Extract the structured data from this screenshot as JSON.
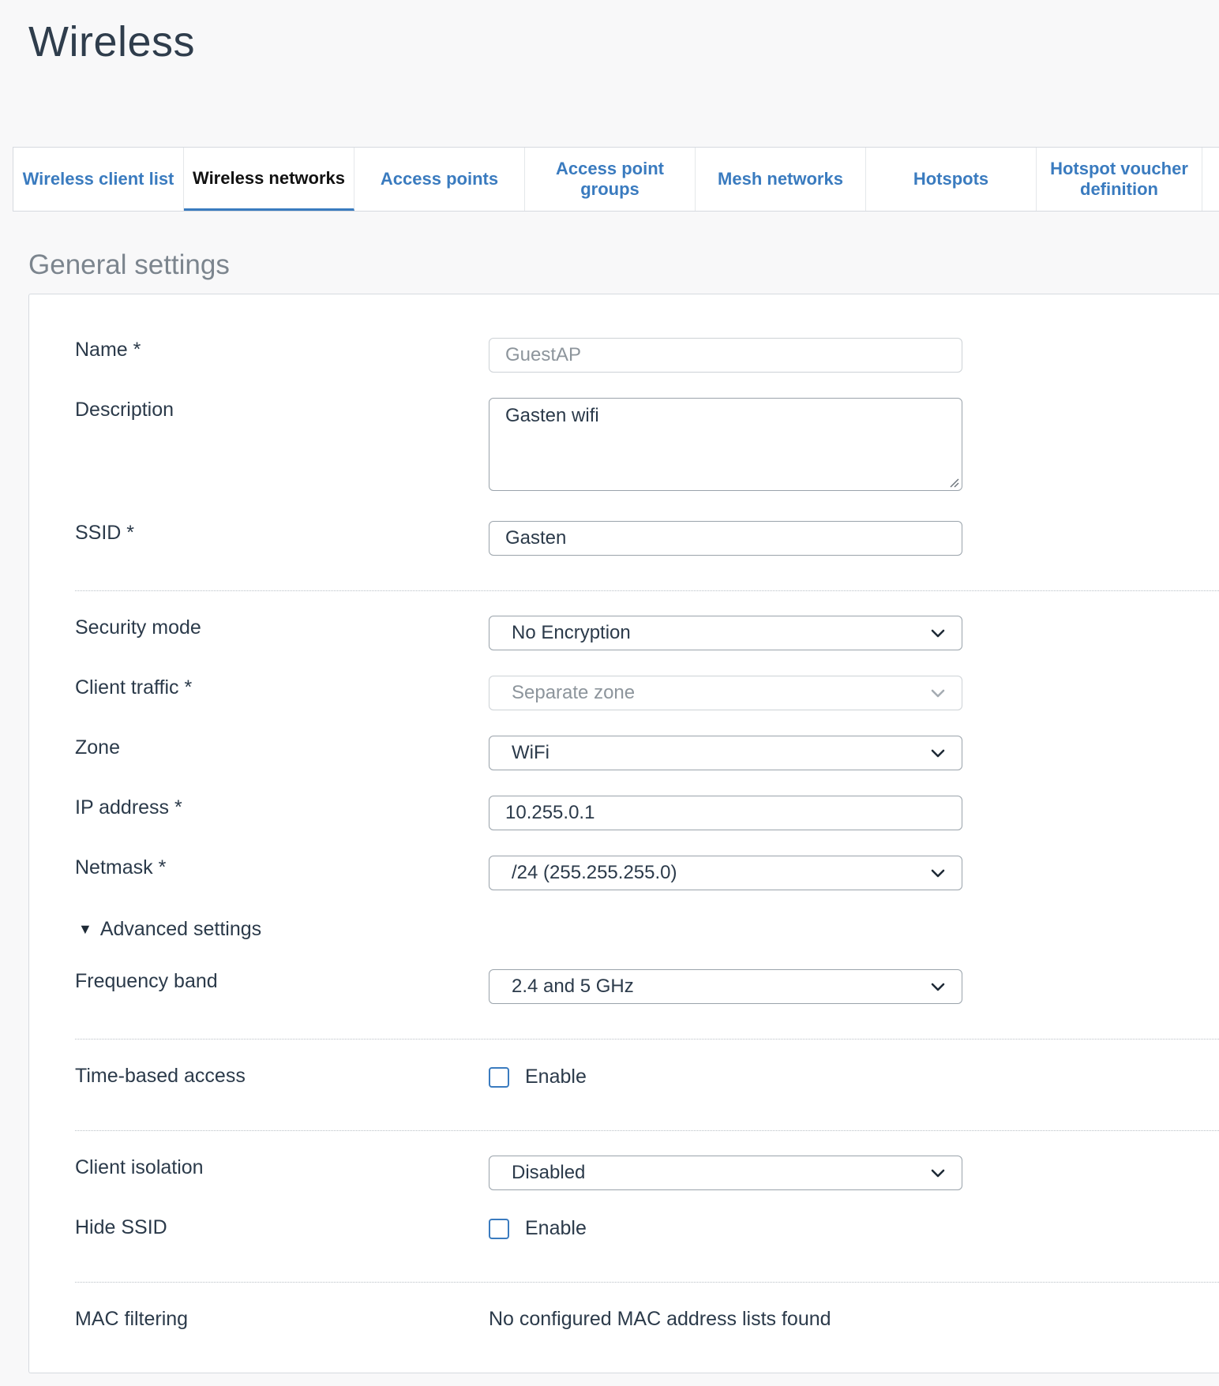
{
  "page": {
    "title": "Wireless"
  },
  "tabs": [
    {
      "label": "Wireless client list",
      "active": false
    },
    {
      "label": "Wireless networks",
      "active": true
    },
    {
      "label": "Access points",
      "active": false
    },
    {
      "label": "Access point groups",
      "active": false
    },
    {
      "label": "Mesh networks",
      "active": false
    },
    {
      "label": "Hotspots",
      "active": false
    },
    {
      "label": "Hotspot voucher definition",
      "active": false
    }
  ],
  "section": {
    "title": "General settings"
  },
  "form": {
    "name": {
      "label": "Name *",
      "value": "GuestAP",
      "disabled": true
    },
    "description": {
      "label": "Description",
      "value": "Gasten wifi"
    },
    "ssid": {
      "label": "SSID *",
      "value": "Gasten"
    },
    "security_mode": {
      "label": "Security mode",
      "value": "No Encryption"
    },
    "client_traffic": {
      "label": "Client traffic *",
      "value": "Separate zone",
      "disabled": true
    },
    "zone": {
      "label": "Zone",
      "value": "WiFi"
    },
    "ip_address": {
      "label": "IP address *",
      "value": "10.255.0.1"
    },
    "netmask": {
      "label": "Netmask *",
      "value": "/24 (255.255.255.0)"
    },
    "advanced": {
      "label": "Advanced settings",
      "expanded": true
    },
    "frequency_band": {
      "label": "Frequency band",
      "value": "2.4 and 5 GHz"
    },
    "time_based_access": {
      "label": "Time-based access",
      "checkbox_label": "Enable",
      "checked": false
    },
    "client_isolation": {
      "label": "Client isolation",
      "value": "Disabled"
    },
    "hide_ssid": {
      "label": "Hide SSID",
      "checkbox_label": "Enable",
      "checked": false
    },
    "mac_filtering": {
      "label": "MAC filtering",
      "value": "No configured MAC address lists found"
    }
  },
  "icons": {
    "chevron": "chevron-down-icon",
    "triangle": "triangle-down-icon",
    "resize": "resize-grip-icon"
  },
  "colors": {
    "accent": "#3a7bbf",
    "text": "#2b3a4a",
    "background": "#f8f8f9"
  }
}
